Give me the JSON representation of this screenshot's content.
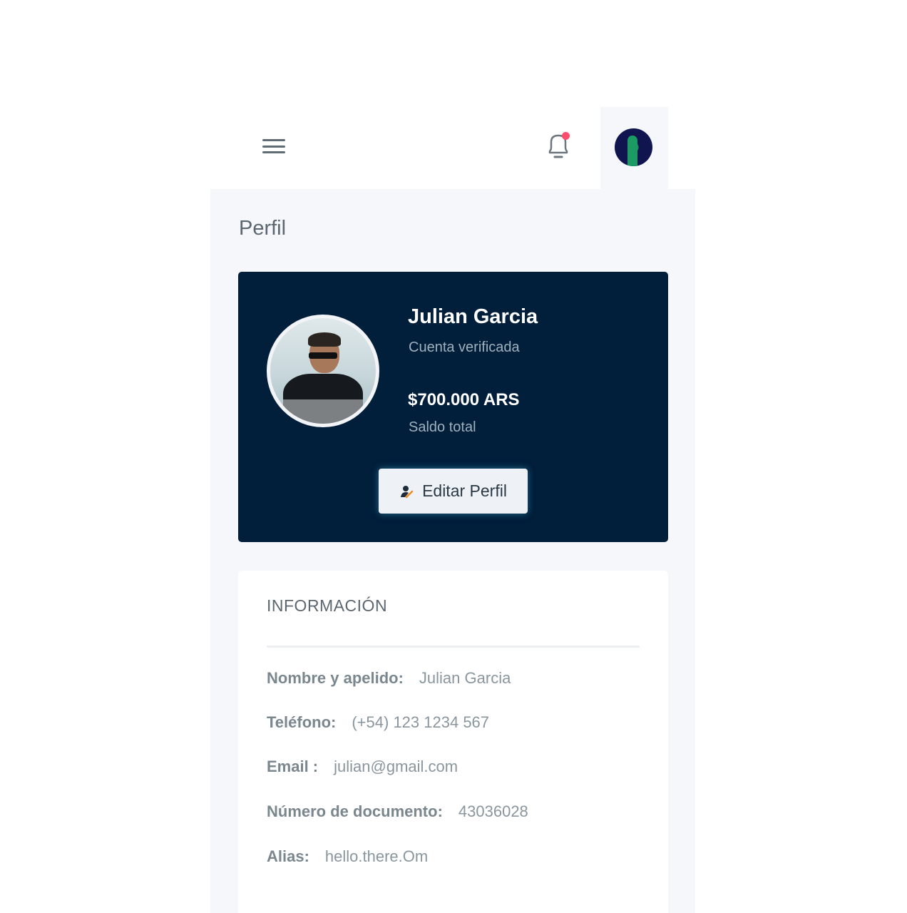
{
  "header": {
    "menu_icon": "hamburger-menu-icon",
    "notification_icon": "bell-icon",
    "notification_badge_color": "#ff4d6d",
    "avatar": "user-avatar"
  },
  "page": {
    "title": "Perfil"
  },
  "profile_card": {
    "name": "Julian Garcia",
    "status": "Cuenta verificada",
    "balance": "$700.000 ARS",
    "balance_label": "Saldo total",
    "edit_button_label": "Editar Perfil",
    "edit_icon": "user-edit-icon",
    "background_color": "#011e3a"
  },
  "info": {
    "title": "INFORMACIÓN",
    "rows": [
      {
        "label": "Nombre y apelido:",
        "value": "Julian Garcia"
      },
      {
        "label": "Teléfono:",
        "value": "(+54) 123 1234 567"
      },
      {
        "label": "Email :",
        "value": "julian@gmail.com"
      },
      {
        "label": "Número de documento:",
        "value": "43036028"
      },
      {
        "label": "Alias:",
        "value": "hello.there.Om"
      }
    ]
  }
}
